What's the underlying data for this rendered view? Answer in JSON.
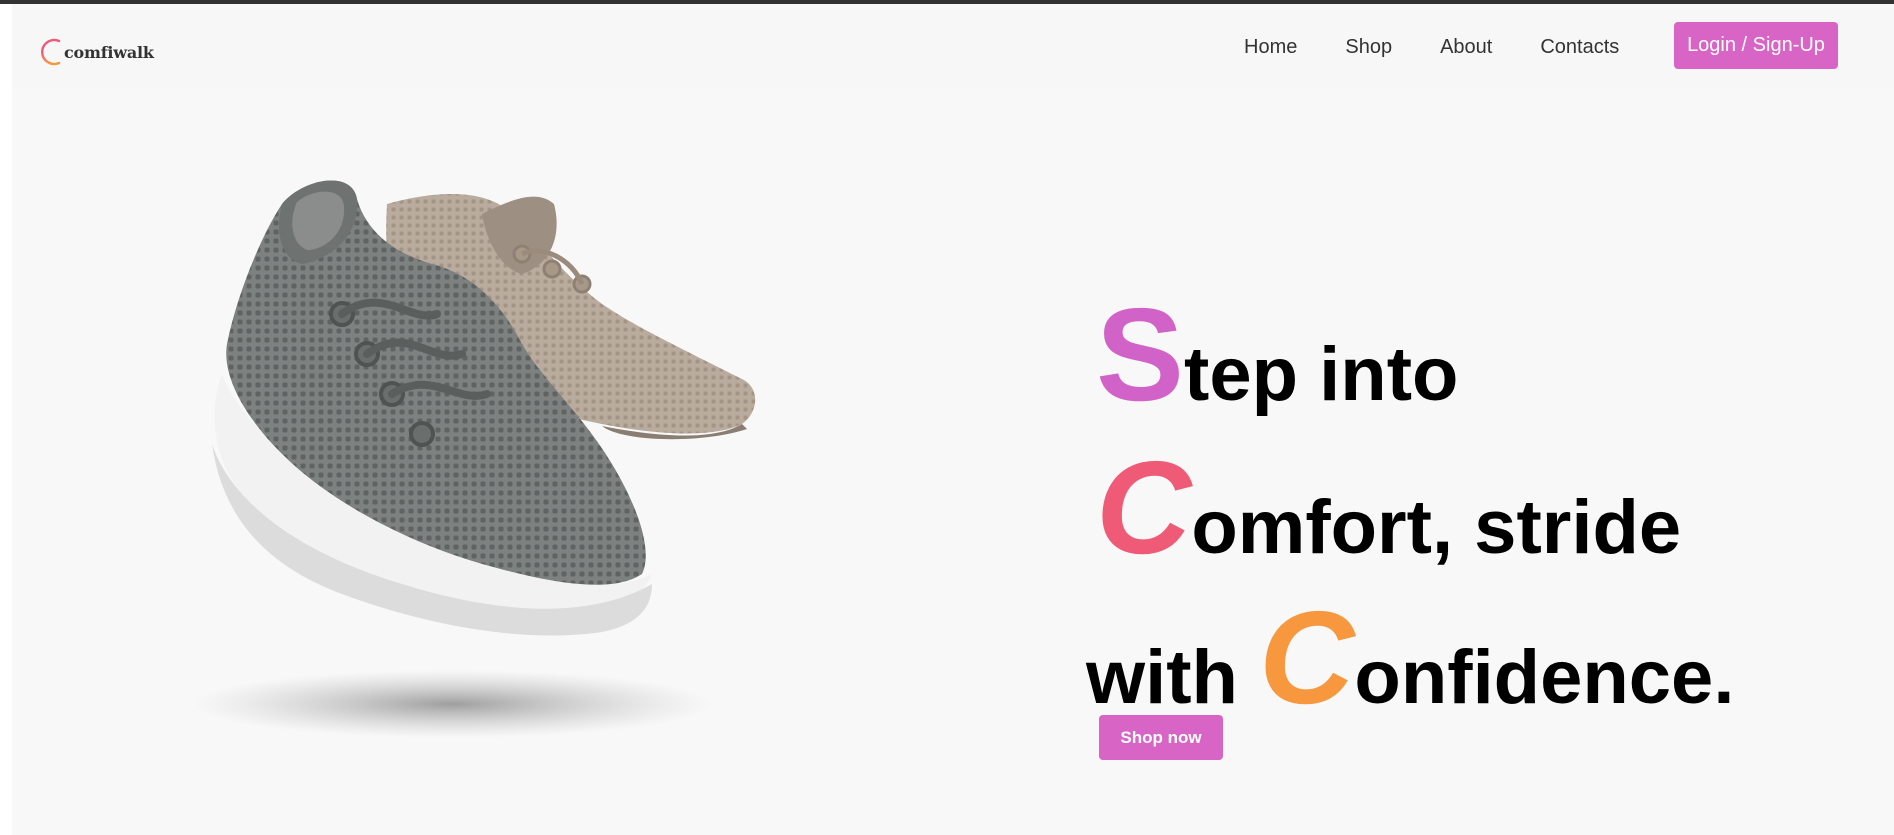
{
  "brand": {
    "name": "comfiwalk",
    "logo_icon": "arc-logo-icon",
    "colors": [
      "#ef5a77",
      "#f7983e",
      "#d162c8"
    ]
  },
  "nav": {
    "links": [
      {
        "label": "Home"
      },
      {
        "label": "Shop"
      },
      {
        "label": "About"
      },
      {
        "label": "Contacts"
      }
    ],
    "login_label": "Login / Sign-Up",
    "accent_color": "#d864c6"
  },
  "hero": {
    "image": "sneaker-pair-image",
    "line1": {
      "cap": "S",
      "rest": "tep into"
    },
    "line2": {
      "cap": "C",
      "rest": "omfort, stride"
    },
    "line3": {
      "pre": "with ",
      "cap": "C",
      "rest": "onfidence."
    },
    "cap_colors": {
      "s": "#d162c8",
      "c1": "#ef5a77",
      "c2": "#f7983e"
    },
    "cta_label": "Shop now"
  }
}
